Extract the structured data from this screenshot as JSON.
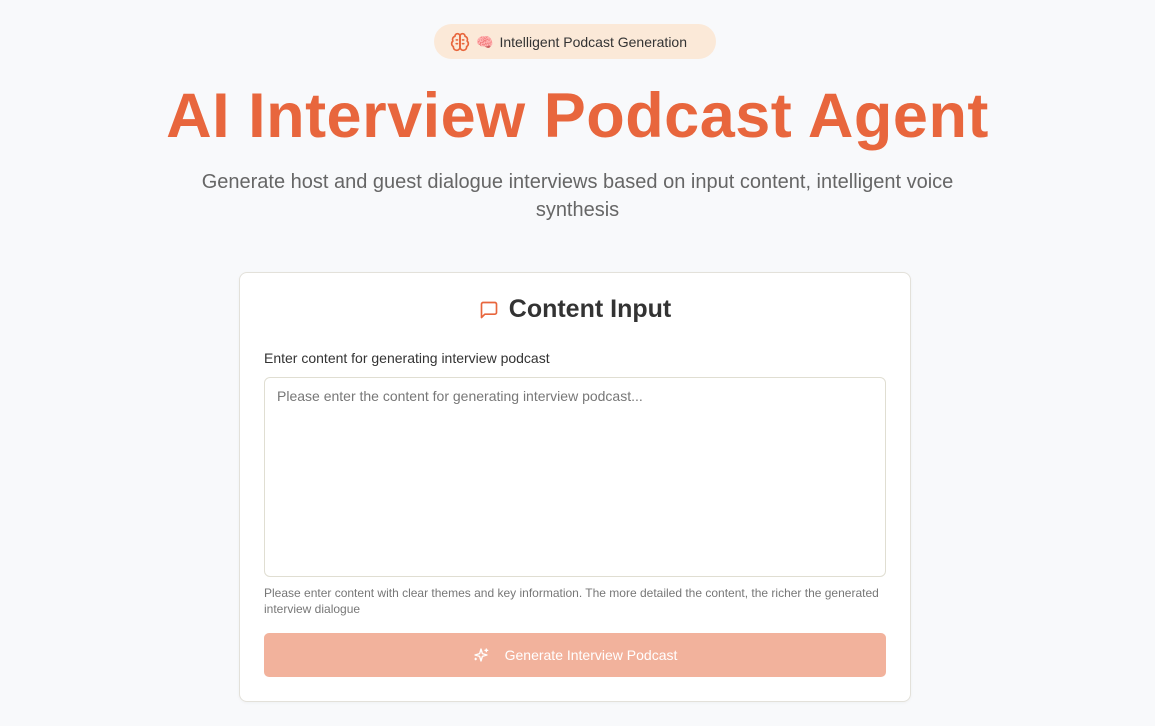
{
  "badge": {
    "emoji": "🧠",
    "label": "Intelligent Podcast Generation"
  },
  "hero": {
    "title": "AI Interview Podcast Agent",
    "subtitle": "Generate host and guest dialogue interviews based on input content, intelligent voice synthesis"
  },
  "card": {
    "title": "Content Input",
    "field_label": "Enter content for generating interview podcast",
    "textarea_value": "",
    "textarea_placeholder": "Please enter the content for generating interview podcast...",
    "help_text": "Please enter content with clear themes and key information. The more detailed the content, the richer the generated interview dialogue",
    "button_label": "Generate Interview Podcast"
  },
  "icons": {
    "badge_icon": "brain-icon",
    "card_icon": "message-square-icon",
    "button_icon": "sparkles-icon"
  },
  "colors": {
    "accent": "#e8663d",
    "badge_bg": "#fbe9d8",
    "button_disabled": "#f2b29c",
    "page_bg": "#f8f9fb"
  }
}
